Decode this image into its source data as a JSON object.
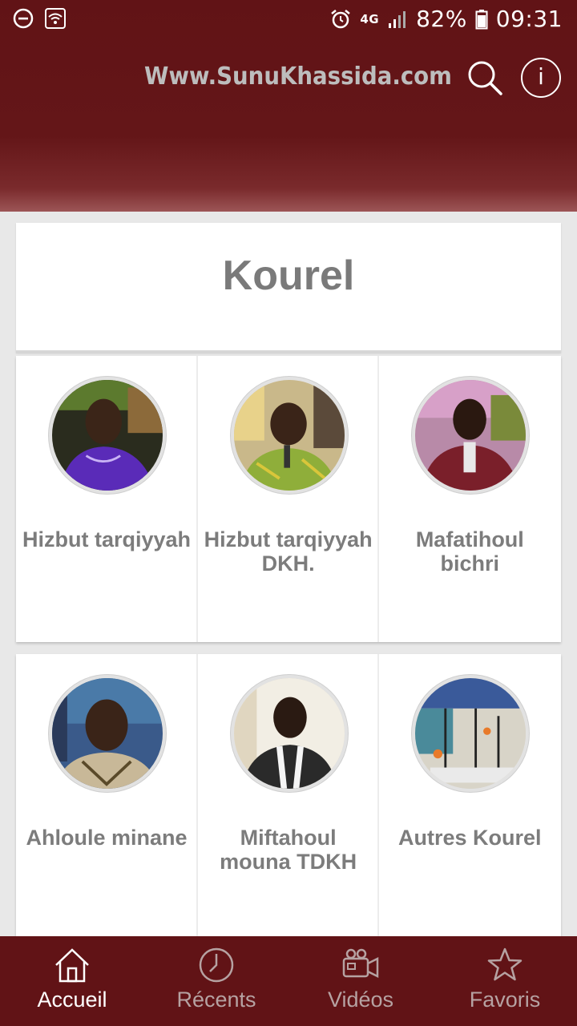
{
  "status_bar": {
    "battery": "82%",
    "time": "09:31",
    "network": "4G"
  },
  "toolbar": {
    "title": "Www.SunuKhassida.com",
    "info_label": "i"
  },
  "section": {
    "title": "Kourel"
  },
  "items": [
    {
      "label": "Hizbut tarqiyyah"
    },
    {
      "label": "Hizbut tarqiyyah DKH."
    },
    {
      "label": "Mafatihoul bichri"
    },
    {
      "label": "Ahloule minane"
    },
    {
      "label": "Miftahoul mouna TDKH"
    },
    {
      "label": "Autres Kourel"
    }
  ],
  "bottom_nav": [
    {
      "label": "Accueil",
      "icon": "home-icon",
      "active": true
    },
    {
      "label": "Récents",
      "icon": "clock-icon",
      "active": false
    },
    {
      "label": "Vidéos",
      "icon": "video-camera-icon",
      "active": false
    },
    {
      "label": "Favoris",
      "icon": "star-icon",
      "active": false
    }
  ],
  "colors": {
    "header": "#611316",
    "bottom_nav": "#611316",
    "title_text": "#bdbdbd",
    "label_text": "#7c7c7c"
  }
}
